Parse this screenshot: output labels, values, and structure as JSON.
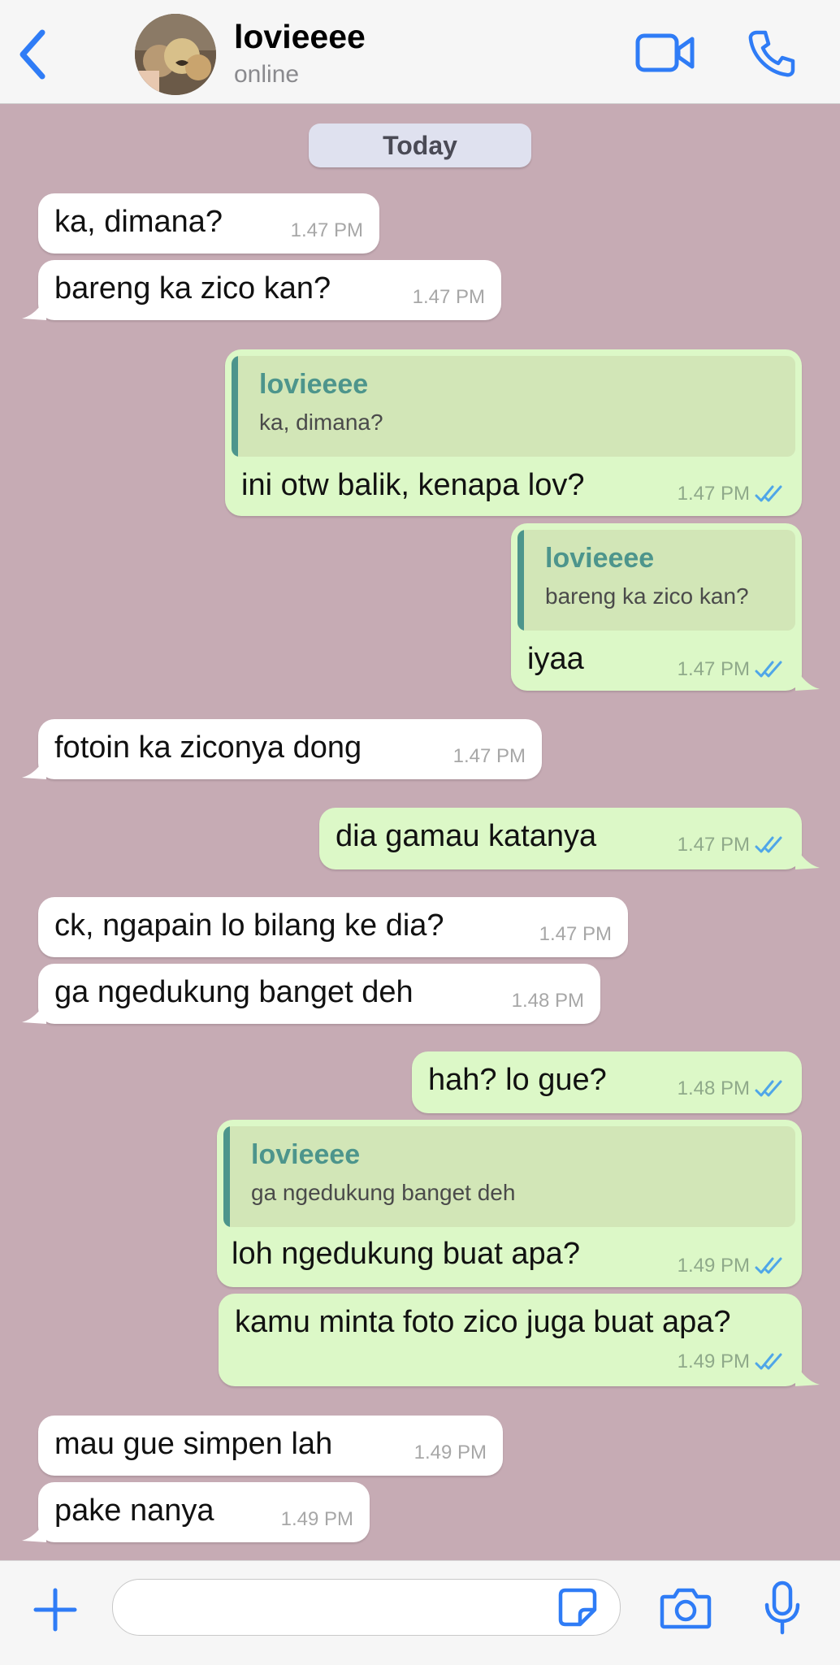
{
  "header": {
    "contact_name": "lovieeee",
    "status": "online"
  },
  "day_label": "Today",
  "colors": {
    "accent": "#2f7cf6",
    "chat_background": "#c6abb4",
    "incoming_bubble": "#ffffff",
    "outgoing_bubble": "#dcf8c7",
    "quote_accent": "#4d958c",
    "read_ticks": "#4fa6e8"
  },
  "messages": [
    {
      "direction": "in",
      "text": "ka, dimana?",
      "time": "1.47 PM"
    },
    {
      "direction": "in",
      "text": "bareng ka zico kan?",
      "time": "1.47 PM"
    },
    {
      "direction": "out",
      "quote_name": "lovieeee",
      "quote_text": "ka, dimana?",
      "text": "ini otw balik, kenapa lov?",
      "time": "1.47 PM",
      "status": "read"
    },
    {
      "direction": "out",
      "quote_name": "lovieeee",
      "quote_text": "bareng ka zico kan?",
      "text": "iyaa",
      "time": "1.47 PM",
      "status": "read"
    },
    {
      "direction": "in",
      "text": "fotoin ka ziconya dong",
      "time": "1.47 PM"
    },
    {
      "direction": "out",
      "text": "dia gamau katanya",
      "time": "1.47 PM",
      "status": "read"
    },
    {
      "direction": "in",
      "text": "ck, ngapain lo bilang ke dia?",
      "time": "1.47 PM"
    },
    {
      "direction": "in",
      "text": "ga ngedukung banget deh",
      "time": "1.48 PM"
    },
    {
      "direction": "out",
      "text": "hah? lo gue?",
      "time": "1.48 PM",
      "status": "read"
    },
    {
      "direction": "out",
      "quote_name": "lovieeee",
      "quote_text": "ga ngedukung banget deh",
      "text": "loh ngedukung buat apa?",
      "time": "1.49 PM",
      "status": "read"
    },
    {
      "direction": "out",
      "text": "kamu minta foto zico juga buat apa?",
      "time": "1.49 PM",
      "status": "read"
    },
    {
      "direction": "in",
      "text": "mau gue simpen lah",
      "time": "1.49 PM"
    },
    {
      "direction": "in",
      "text": "pake nanya",
      "time": "1.49 PM"
    }
  ],
  "composer": {
    "placeholder": "",
    "icons": [
      "plus-icon",
      "sticker-icon",
      "camera-icon",
      "microphone-icon"
    ]
  }
}
